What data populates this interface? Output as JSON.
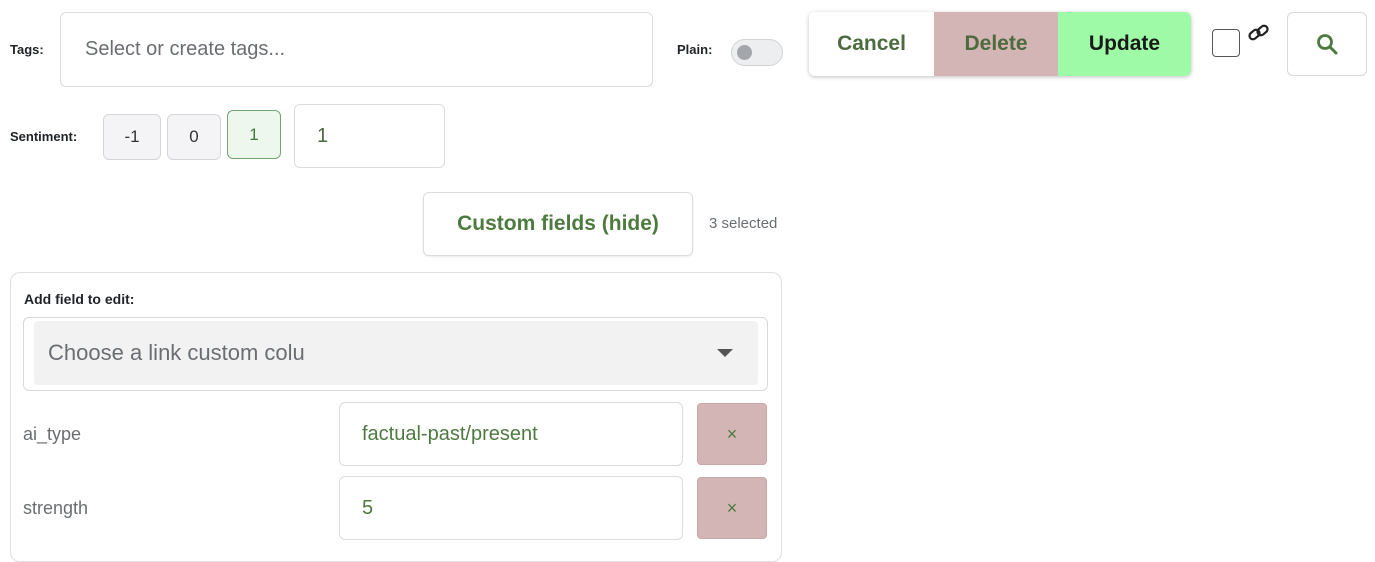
{
  "tags": {
    "label": "Tags:",
    "placeholder": "Select or create tags..."
  },
  "plain": {
    "label": "Plain:",
    "enabled": false
  },
  "actions": {
    "cancel_label": "Cancel",
    "delete_label": "Delete",
    "update_label": "Update"
  },
  "link_checkbox": {
    "checked": false,
    "icon": "link-icon"
  },
  "search": {
    "icon": "search-icon"
  },
  "sentiment": {
    "label": "Sentiment:",
    "options": [
      "-1",
      "0",
      "1"
    ],
    "selected": "1",
    "value": "1"
  },
  "custom_fields": {
    "toggle_label": "Custom fields (hide)",
    "selected_count": "3 selected",
    "add_label": "Add field to edit:",
    "select_placeholder": "Choose a link custom colu",
    "fields": [
      {
        "name": "ai_type",
        "value": "factual-past/present",
        "remove_label": "×"
      },
      {
        "name": "strength",
        "value": "5",
        "remove_label": "×"
      }
    ]
  },
  "colors": {
    "accent_green": "#4d7a3f",
    "update_bg": "#9ffaa7",
    "delete_bg": "#d4b5b5"
  }
}
